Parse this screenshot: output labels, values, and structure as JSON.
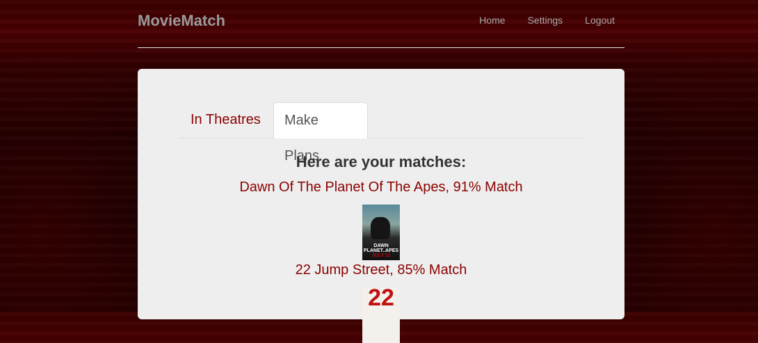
{
  "nav": {
    "brand": "MovieMatch",
    "links": [
      "Home",
      "Settings",
      "Logout"
    ]
  },
  "tabs": [
    {
      "label": "In Theatres",
      "active": false
    },
    {
      "label": "Make Plans",
      "active": true
    }
  ],
  "heading": "Here are your matches:",
  "matches": [
    {
      "title": "Dawn Of The Planet Of The Apes, 91% Match",
      "poster_text": "DAWN PLANET APES"
    },
    {
      "title": "22 Jump Street, 85% Match",
      "poster_text": "22"
    }
  ],
  "colors": {
    "accent": "#8b0000",
    "panel": "#eeeeee"
  }
}
